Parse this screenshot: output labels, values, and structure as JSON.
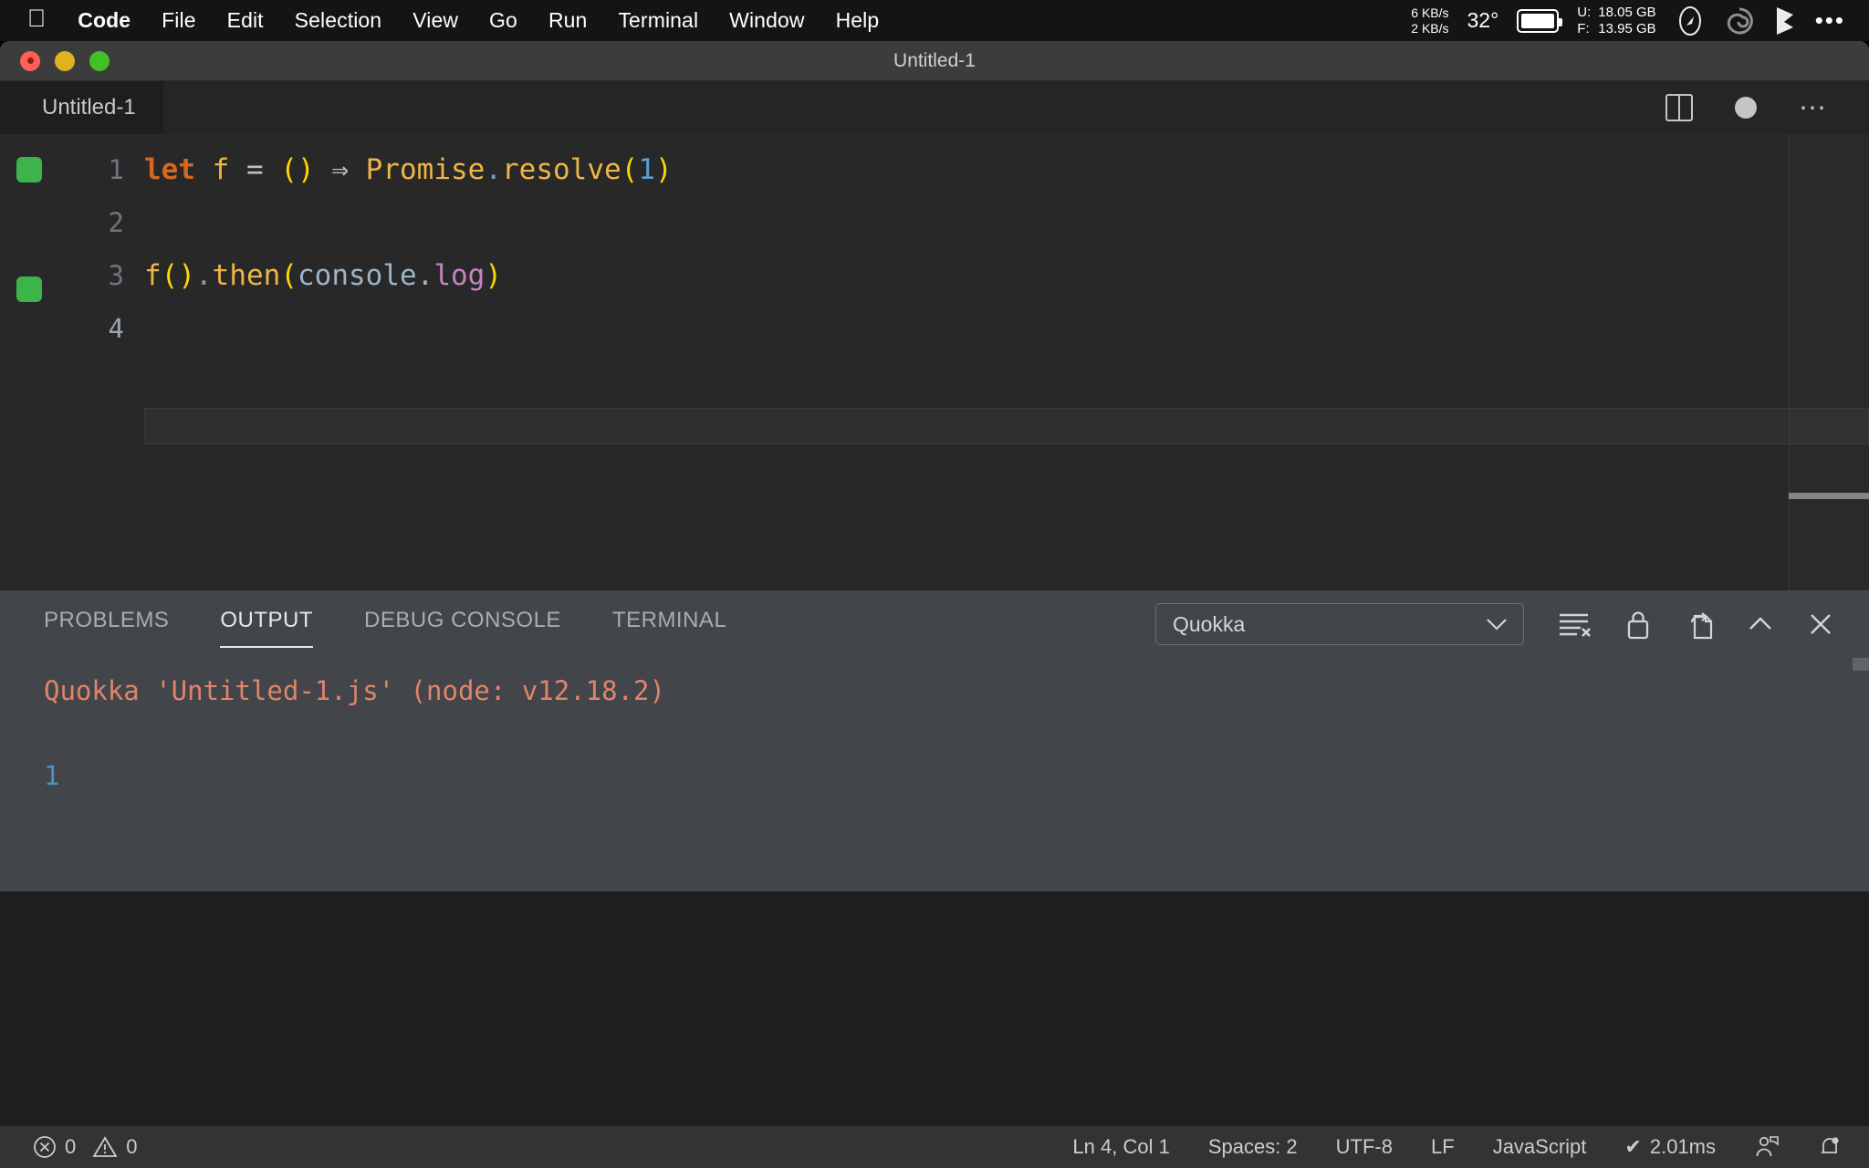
{
  "menubar": {
    "apple_icon": "apple-logo-icon",
    "items": [
      {
        "label": "Code",
        "bold": true
      },
      {
        "label": "File",
        "bold": false
      },
      {
        "label": "Edit",
        "bold": false
      },
      {
        "label": "Selection",
        "bold": false
      },
      {
        "label": "View",
        "bold": false
      },
      {
        "label": "Go",
        "bold": false
      },
      {
        "label": "Run",
        "bold": false
      },
      {
        "label": "Terminal",
        "bold": false
      },
      {
        "label": "Window",
        "bold": false
      },
      {
        "label": "Help",
        "bold": false
      }
    ],
    "status": {
      "net_up": "6 KB/s",
      "net_down": "2 KB/s",
      "temperature": "32°",
      "battery_icon": "battery-icon",
      "mem_used_label": "U:",
      "mem_used_value": "18.05 GB",
      "mem_free_label": "F:",
      "mem_free_value": "13.95 GB",
      "icon_1": "compass-icon",
      "icon_2": "spiral-icon",
      "icon_3": "flag-icon",
      "icon_4": "control-center-ellipsis-icon"
    }
  },
  "window": {
    "title": "Untitled-1",
    "traffic": {
      "close": "close-window-button",
      "minimize": "minimize-window-button",
      "maximize": "maximize-window-button"
    }
  },
  "editor": {
    "tab_label": "Untitled-1",
    "actions": {
      "split": "split-editor-icon",
      "dirty": "unsaved-indicator",
      "more": "more-actions-icon"
    },
    "lines": [
      {
        "num": "1",
        "marked": true
      },
      {
        "num": "2",
        "marked": false
      },
      {
        "num": "3",
        "marked": true
      },
      {
        "num": "4",
        "marked": false
      }
    ],
    "code": {
      "line1": {
        "kw": "let",
        "space1": " ",
        "ident": "f",
        "eq": " = ",
        "parens": "()",
        "arrow": " ⇒ ",
        "obj": "Promise",
        "dot": ".",
        "method": "resolve",
        "open": "(",
        "num": "1",
        "close": ")"
      },
      "line3": {
        "ident": "f",
        "call": "()",
        "dot": ".",
        "method": "then",
        "open": "(",
        "obj": "console",
        "dot2": ".",
        "prop": "log",
        "close": ")"
      }
    },
    "plain_text": "let f = () => Promise.resolve(1)\n\nf().then(console.log)\n"
  },
  "panel": {
    "tabs": [
      {
        "label": "PROBLEMS",
        "active": false
      },
      {
        "label": "OUTPUT",
        "active": true
      },
      {
        "label": "DEBUG CONSOLE",
        "active": false
      },
      {
        "label": "TERMINAL",
        "active": false
      }
    ],
    "channel_select": {
      "value": "Quokka",
      "chevron": "chevron-down-icon"
    },
    "actions": {
      "clear": "clear-output-icon",
      "lock": "lock-scroll-icon",
      "open_editor": "open-in-editor-icon",
      "collapse": "collapse-panel-icon",
      "close": "close-panel-icon"
    },
    "output": {
      "header": "Quokka 'Untitled-1.js' (node: v12.18.2)",
      "value": "1"
    }
  },
  "statusbar": {
    "errors_icon": "error-circle-icon",
    "errors": "0",
    "warnings_icon": "warning-triangle-icon",
    "warnings": "0",
    "cursor": "Ln 4, Col 1",
    "indent": "Spaces: 2",
    "encoding": "UTF-8",
    "eol": "LF",
    "language": "JavaScript",
    "quokka_check": "✔",
    "quokka_time": "2.01ms",
    "feedback_icon": "feedback-person-icon",
    "bell_icon": "notification-bell-icon"
  },
  "colors": {
    "editor_bg": "#282828",
    "panel_bg": "#424549",
    "statusbar_bg": "#333333",
    "titlebar_bg": "#3c3c3c",
    "quokka_marker": "#3cb44a",
    "output_header": "#e0846a",
    "output_value": "#4f90c0"
  }
}
